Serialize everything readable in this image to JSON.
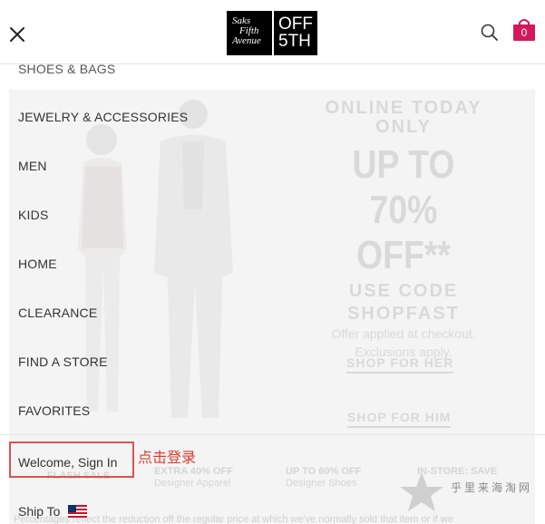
{
  "header": {
    "close_icon": "close-icon",
    "logo": {
      "saks_lines": [
        "Saks",
        "Fifth",
        "Avenue"
      ],
      "off_lines": [
        "OFF",
        "5TH"
      ]
    },
    "search_icon": "search-icon",
    "bag_count": "0",
    "accent_color": "#d1185a"
  },
  "menu": {
    "partial_item": "SHOES & BAGS",
    "items": [
      "JEWELRY & ACCESSORIES",
      "MEN",
      "KIDS",
      "HOME",
      "CLEARANCE",
      "FIND A STORE",
      "FAVORITES"
    ],
    "sign_in": "Welcome, Sign In",
    "ship_to": "Ship To"
  },
  "annotation": "点击登录",
  "promo": {
    "line1": "ONLINE TODAY",
    "line2": "ONLY",
    "upto": "UP TO 70%",
    "off": "OFF**",
    "use_code": "USE CODE",
    "code": "SHOPFAST",
    "applied": "Offer applied at checkout.",
    "exclusions": "Exclusions apply.",
    "shop_her": "SHOP FOR HER",
    "shop_him": "SHOP FOR HIM"
  },
  "deals": {
    "flash": "FLASH SALE",
    "d1_title": "EXTRA 40% OFF",
    "d1_sub": "Designer Apparel",
    "d2_title": "UP TO 60% OFF",
    "d2_sub": "Designer Shoes",
    "d3_title": "IN-STORE: SAVE"
  },
  "disclaimer": "Percentages reflect the reduction off the regular price at which we've normally sold that item or if we",
  "watermark": "乎里来海淘网"
}
